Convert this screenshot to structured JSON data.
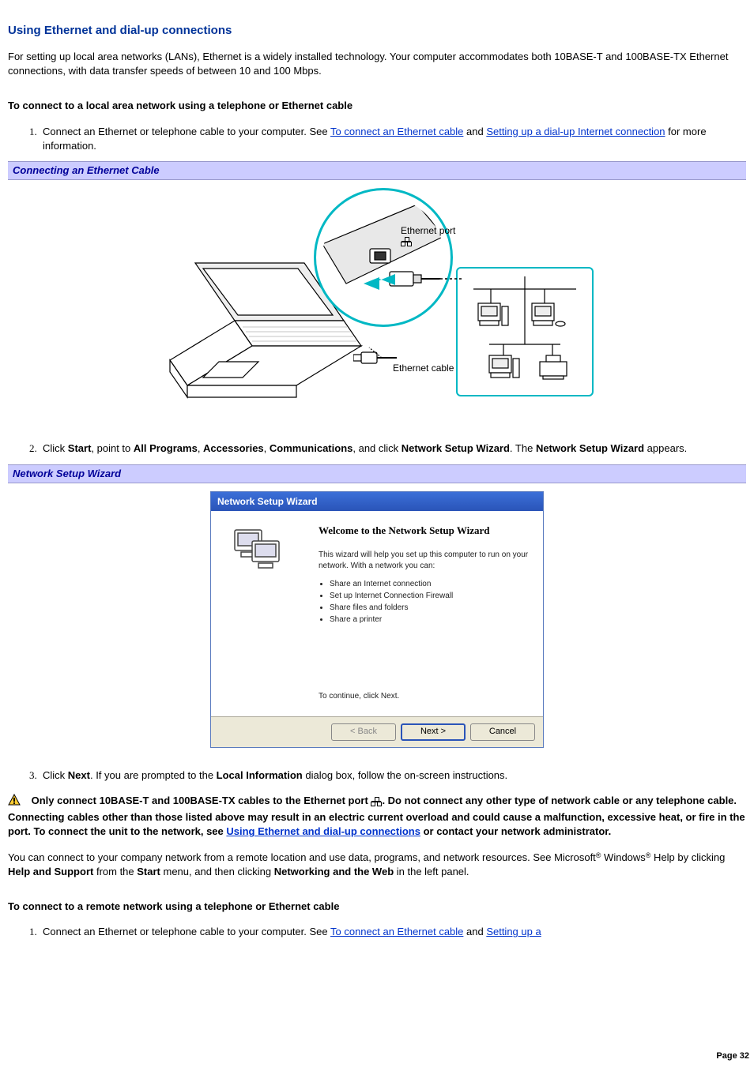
{
  "title": "Using Ethernet and dial-up connections",
  "intro": "For setting up local area networks (LANs), Ethernet is a widely installed technology. Your computer accommodates both 10BASE-T and 100BASE-TX Ethernet connections, with data transfer speeds of between 10 and 100 Mbps.",
  "sub1": "To connect to a local area network using a telephone or Ethernet cable",
  "step1_a": "Connect an Ethernet or telephone cable to your computer. See ",
  "step1_link1": "To connect an Ethernet cable",
  "step1_b": " and ",
  "step1_link2": "Setting up a dial-up Internet connection",
  "step1_c": " for more information.",
  "caption1": "Connecting an Ethernet Cable",
  "fig1_port_label": "Ethernet port",
  "fig1_cable_label": "Ethernet cable",
  "step2_a": "Click ",
  "step2_start": "Start",
  "step2_b": ", point to ",
  "step2_allprograms": "All Programs",
  "step2_c": ", ",
  "step2_accessories": "Accessories",
  "step2_d": ", ",
  "step2_comm": "Communications",
  "step2_e": ", and click ",
  "step2_nsw": "Network Setup Wizard",
  "step2_f": ". The ",
  "step2_nsw2": "Network Setup Wizard",
  "step2_g": " appears.",
  "caption2": "Network Setup Wizard",
  "wizard": {
    "title": "Network Setup Wizard",
    "heading": "Welcome to the Network Setup Wizard",
    "desc": "This wizard will help you set up this computer to run on your network. With a network you can:",
    "items": [
      "Share an Internet connection",
      "Set up Internet Connection Firewall",
      "Share files and folders",
      "Share a printer"
    ],
    "continue": "To continue, click Next.",
    "back": "< Back",
    "next": "Next >",
    "cancel": "Cancel"
  },
  "step3_a": "Click ",
  "step3_next": "Next",
  "step3_b": ". If you are prompted to the ",
  "step3_local": "Local Information",
  "step3_c": " dialog box, follow the on-screen instructions.",
  "warn_a": "Only connect 10BASE-T and 100BASE-TX cables to the Ethernet port ",
  "warn_b": ". Do not connect any other type of network cable or any telephone cable. Connecting cables other than those listed above may result in an electric current overload and could cause a malfunction, excessive heat, or fire in the port. To connect the unit to the network, see ",
  "warn_link": "Using Ethernet and dial-up connections",
  "warn_c": " or contact your network administrator.",
  "para_remote_a": "You can connect to your company network from a remote location and use data, programs, and network resources. See Microsoft",
  "para_remote_b": " Windows",
  "para_remote_c": " Help by clicking ",
  "para_remote_help": "Help and Support",
  "para_remote_d": " from the ",
  "para_remote_start": "Start",
  "para_remote_e": " menu, and then clicking ",
  "para_remote_netweb": "Networking and the Web",
  "para_remote_f": " in the left panel.",
  "sub2": "To connect to a remote network using a telephone or Ethernet cable",
  "step_r1_a": "Connect an Ethernet or telephone cable to your computer. See ",
  "step_r1_link1": "To connect an Ethernet cable",
  "step_r1_b": " and ",
  "step_r1_link2": "Setting up a",
  "page": "Page 32"
}
